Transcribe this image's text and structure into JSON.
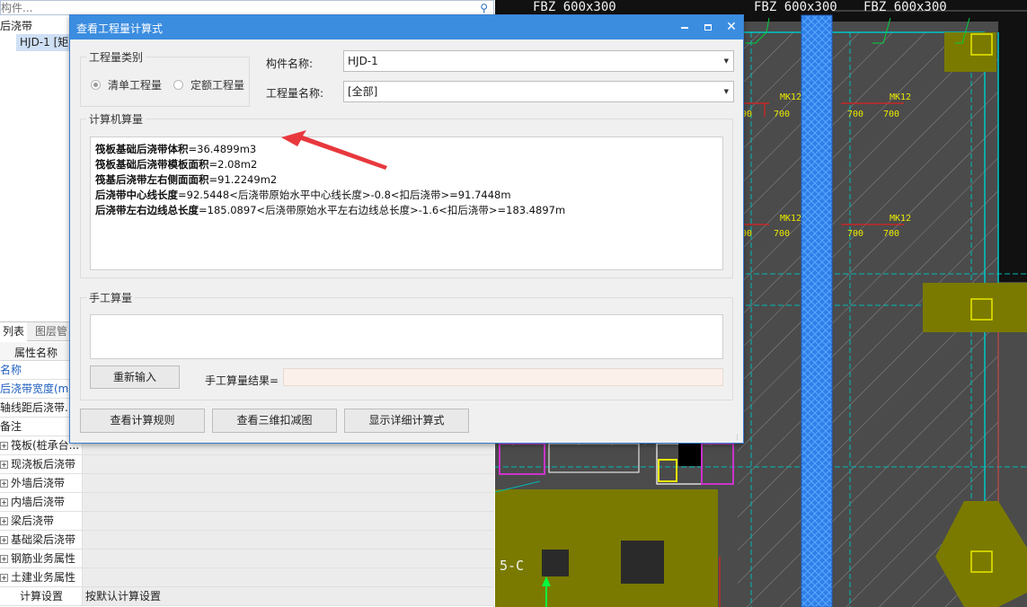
{
  "left_panel": {
    "search_placeholder": "构件...",
    "tree_root": "后浇带",
    "tree_child": "HJD-1 [矩",
    "tab_active": "列表",
    "tab_inactive": "图层管",
    "prop_header": "属性名称",
    "rows": [
      {
        "name": "名称",
        "value": "",
        "style": "blue"
      },
      {
        "name": "后浇带宽度(mm",
        "value": "",
        "style": "blue"
      },
      {
        "name": "轴线距后浇带...",
        "value": "",
        "style": "plain"
      },
      {
        "name": "备注",
        "value": "",
        "style": "plain"
      },
      {
        "name": "筏板(桩承台...",
        "value": "",
        "style": "expand"
      },
      {
        "name": "现浇板后浇带",
        "value": "",
        "style": "expand"
      },
      {
        "name": "外墙后浇带",
        "value": "",
        "style": "expand"
      },
      {
        "name": "内墙后浇带",
        "value": "",
        "style": "expand"
      },
      {
        "name": "梁后浇带",
        "value": "",
        "style": "expand"
      },
      {
        "name": "基础梁后浇带",
        "value": "",
        "style": "expand"
      },
      {
        "name": "钢筋业务属性",
        "value": "",
        "style": "expand"
      },
      {
        "name": "土建业务属性",
        "value": "",
        "style": "expand"
      },
      {
        "name": "计算设置",
        "value": "按默认计算设置",
        "style": "indent"
      }
    ]
  },
  "cad": {
    "labels": {
      "fbz_left": "FBZ 600x300",
      "fbz_mid": "FBZ 600x300",
      "fbz_right": "FBZ 600x300",
      "mk12": "MK12",
      "dim_700": "700",
      "dim_00": "00",
      "axis_label": "5-C"
    },
    "colors": {
      "background": "#4b4b4b",
      "strip": "#2f7fe8",
      "olive": "#7a7a00",
      "cyan": "#00b8b8",
      "red": "#e02020",
      "yellow": "#e8e800"
    }
  },
  "dialog": {
    "title": "查看工程量计算式",
    "window_buttons": {
      "close": "✕"
    },
    "quantity_type_group": "工程量类别",
    "radio_bill": "清单工程量",
    "radio_quota": "定额工程量",
    "component_label": "构件名称:",
    "component_value": "HJD-1",
    "quantity_label": "工程量名称:",
    "quantity_value": "[全部]",
    "computer_group": "计算机算量",
    "calc_lines": [
      {
        "name": "筏板基础后浇带体积",
        "expr": "=36.4899m3"
      },
      {
        "name": "筏板基础后浇带模板面积",
        "expr": "=2.08m2"
      },
      {
        "name": "筏基后浇带左右侧面面积",
        "expr": "=91.2249m2"
      },
      {
        "name": "后浇带中心线长度",
        "expr": "=92.5448<后浇带原始水平中心线长度>-0.8<扣后浇带>=91.7448m"
      },
      {
        "name": "后浇带左右边线总长度",
        "expr": "=185.0897<后浇带原始水平左右边线总长度>-1.6<扣后浇带>=183.4897m"
      }
    ],
    "manual_group": "手工算量",
    "reenter_button": "重新输入",
    "manual_result_label": "手工算量结果=",
    "manual_result_value": "",
    "btn_rules": "查看计算规则",
    "btn_3d": "查看三维扣减图",
    "btn_detail": "显示详细计算式",
    "arrow_color": "#e8383d"
  }
}
